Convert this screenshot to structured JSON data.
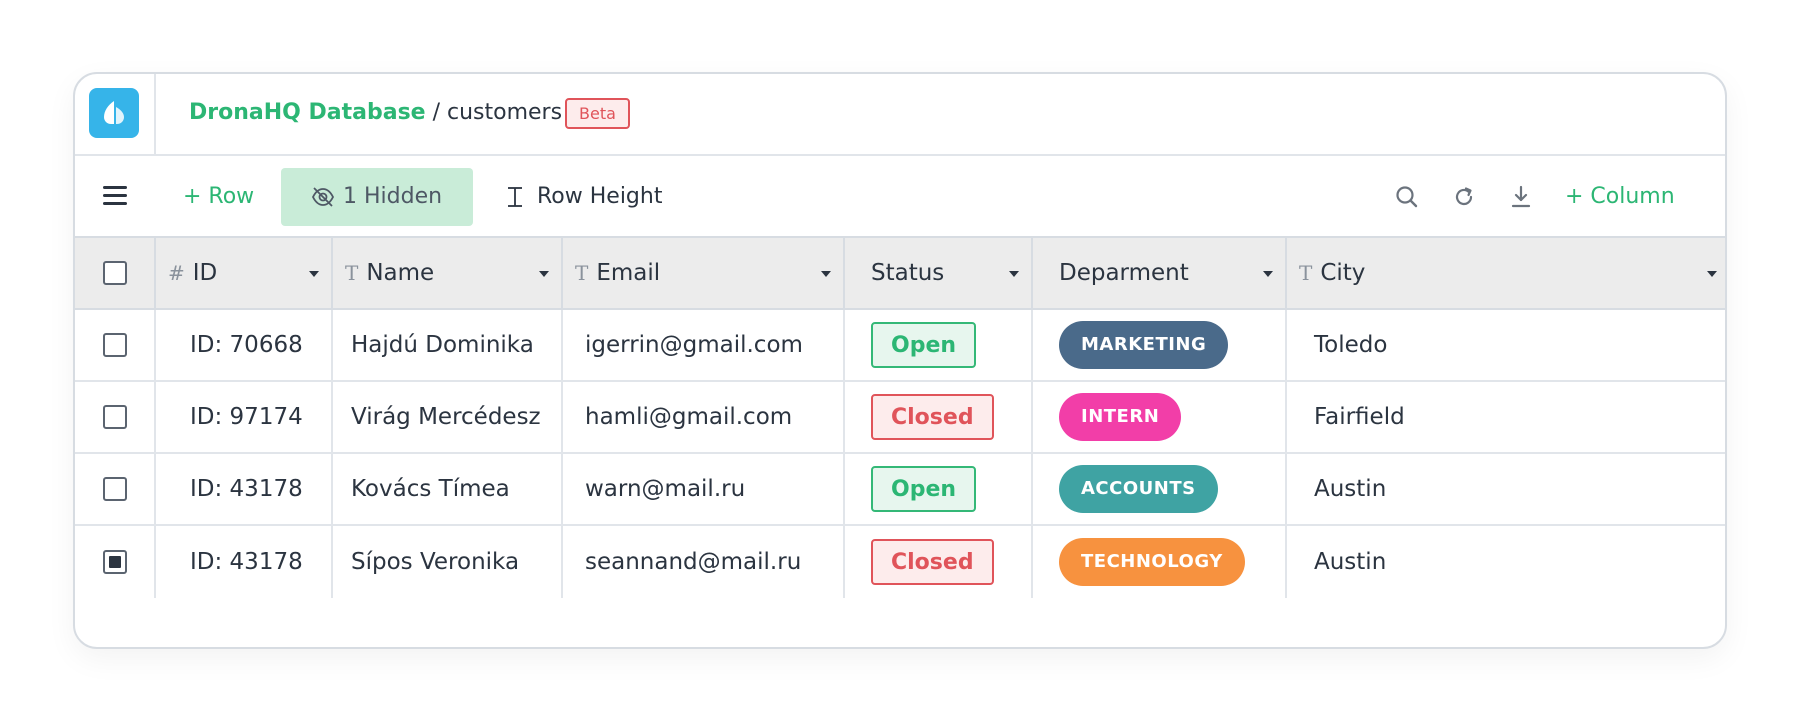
{
  "header": {
    "app_name": "DronaHQ Database",
    "separator": " / ",
    "table_name": "customers",
    "badge": "Beta"
  },
  "toolbar": {
    "add_row_label": "+ Row",
    "hidden_label": "1 Hidden",
    "row_height_label": "Row Height",
    "add_column_label": "+ Column",
    "icons": [
      "menu-icon",
      "eye-off-icon",
      "row-height-icon",
      "search-icon",
      "refresh-icon",
      "download-icon"
    ]
  },
  "table": {
    "columns": [
      {
        "type_glyph": "#",
        "label": "ID"
      },
      {
        "type_glyph": "T",
        "label": "Name"
      },
      {
        "type_glyph": "T",
        "label": "Email"
      },
      {
        "type_glyph": "",
        "label": "Status"
      },
      {
        "type_glyph": "",
        "label": "Deparment"
      },
      {
        "type_glyph": "T",
        "label": "City"
      }
    ],
    "rows": [
      {
        "checked": false,
        "id": "ID: 70668",
        "name": "Hajdú Dominika",
        "email": "igerrin@gmail.com",
        "status": "Open",
        "department": "MARKETING",
        "city": "Toledo"
      },
      {
        "checked": false,
        "id": "ID: 97174",
        "name": "Virág Mercédesz",
        "email": "hamli@gmail.com",
        "status": "Closed",
        "department": "INTERN",
        "city": "Fairfield"
      },
      {
        "checked": false,
        "id": "ID: 43178",
        "name": "Kovács Tímea",
        "email": "warn@mail.ru",
        "status": "Open",
        "department": "ACCOUNTS",
        "city": "Austin"
      },
      {
        "checked": true,
        "id": "ID: 43178",
        "name": "Sípos Veronika",
        "email": "seannand@mail.ru",
        "status": "Closed",
        "department": "TECHNOLOGY",
        "city": "Austin"
      }
    ]
  },
  "colors": {
    "accent": "#2cb674",
    "danger": "#e0545a",
    "logo": "#36b4e9",
    "department": {
      "MARKETING": "#4a6a8a",
      "INTERN": "#f23ea8",
      "ACCOUNTS": "#3fa3a3",
      "TECHNOLOGY": "#f7923f"
    }
  }
}
